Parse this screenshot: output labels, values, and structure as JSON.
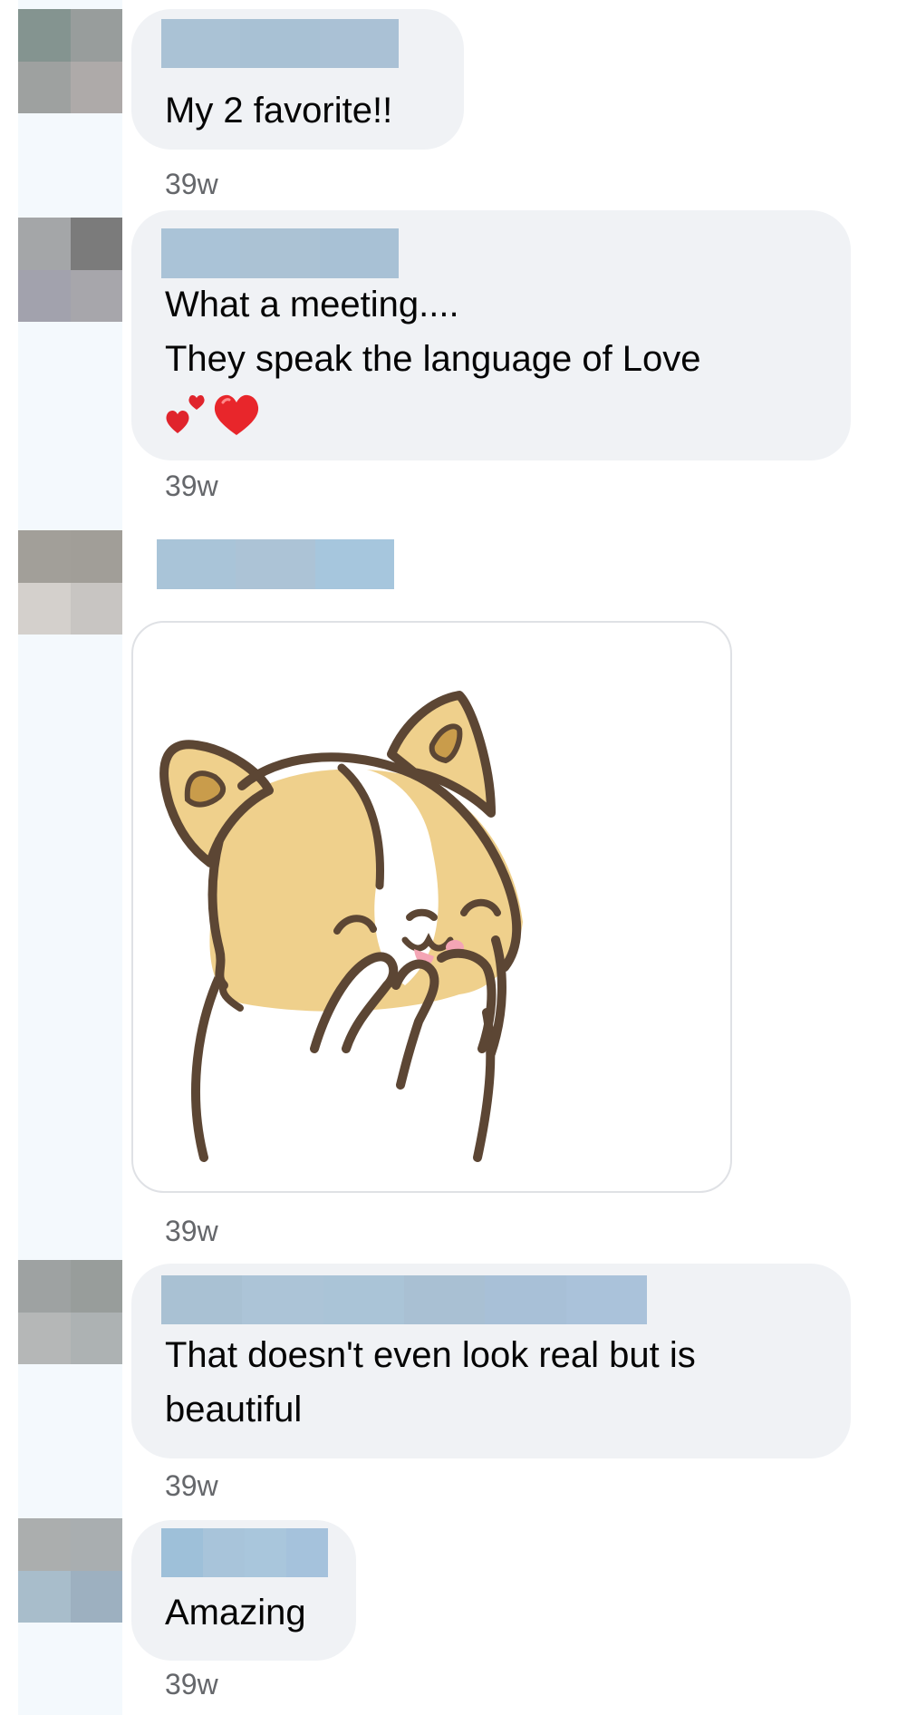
{
  "comments": [
    {
      "text": "My 2 favorite!!",
      "time": "39w"
    },
    {
      "text": "What a meeting....\nThey speak the language of Love",
      "emoji": "💕❤️",
      "time": "39w"
    },
    {
      "sticker": "corgi-covering-face-sticker",
      "time": "39w"
    },
    {
      "text": "That doesn't even look real but is\nbeautiful",
      "time": "39w"
    },
    {
      "text": "Amazing",
      "time": "39w"
    }
  ],
  "colors": {
    "bubble": "#f0f2f5",
    "timestamp": "#65676b",
    "text": "#050505",
    "name_redaction": "#a9c3d6",
    "rail": "#f4f9fd"
  }
}
